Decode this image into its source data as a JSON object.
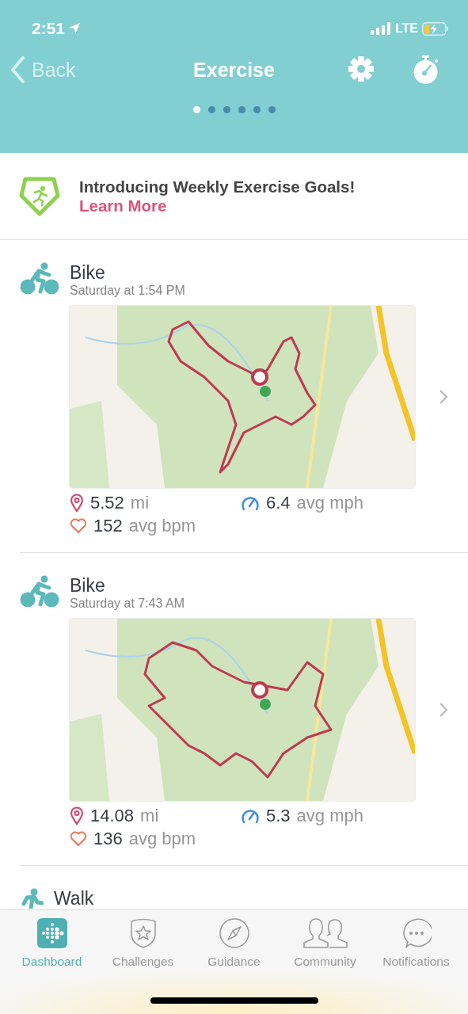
{
  "status_bar": {
    "time": "2:51",
    "network": "LTE"
  },
  "nav": {
    "back": "Back",
    "title": "Exercise"
  },
  "page_dots": [
    {
      "selected": true
    },
    {
      "selected": false
    },
    {
      "selected": false
    },
    {
      "selected": false
    },
    {
      "selected": false
    },
    {
      "selected": false
    }
  ],
  "banner": {
    "title": "Introducing Weekly Exercise Goals!",
    "link": "Learn More"
  },
  "exercises": [
    {
      "kind": "bike",
      "name": "Bike",
      "time": "Saturday at 1:54 PM",
      "stats": [
        {
          "kind": "distance",
          "value": "5.52",
          "unit": "mi"
        },
        {
          "kind": "speed",
          "value": "6.4",
          "unit": "avg mph"
        },
        {
          "kind": "heart",
          "value": "152",
          "unit": "avg bpm"
        }
      ]
    },
    {
      "kind": "bike",
      "name": "Bike",
      "time": "Saturday at 7:43 AM",
      "stats": [
        {
          "kind": "distance",
          "value": "14.08",
          "unit": "mi"
        },
        {
          "kind": "speed",
          "value": "5.3",
          "unit": "avg mph"
        },
        {
          "kind": "heart",
          "value": "136",
          "unit": "avg bpm"
        }
      ]
    },
    {
      "kind": "walk",
      "name": "Walk"
    }
  ],
  "tab_bar": [
    {
      "kind": "dashboard",
      "label": "Dashboard",
      "selected": true
    },
    {
      "kind": "challenges",
      "label": "Challenges",
      "selected": false
    },
    {
      "kind": "guidance",
      "label": "Guidance",
      "selected": false
    },
    {
      "kind": "community",
      "label": "Community",
      "selected": false
    },
    {
      "kind": "notifications",
      "label": "Notifications",
      "selected": false
    }
  ]
}
